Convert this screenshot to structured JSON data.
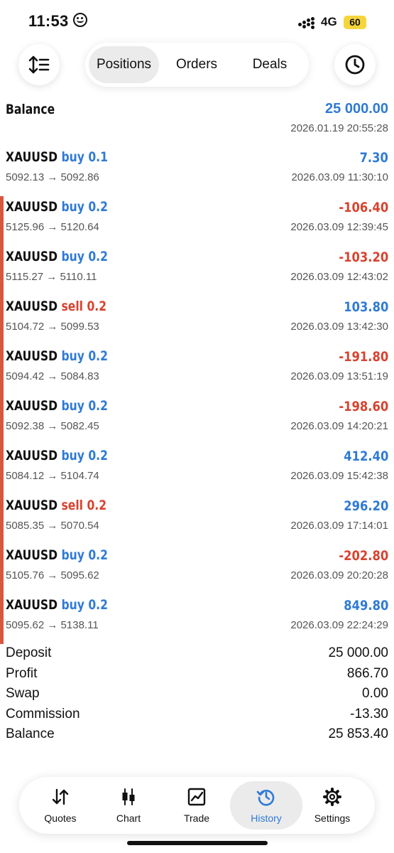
{
  "status": {
    "time": "11:53",
    "network": "4G",
    "battery": "60"
  },
  "header": {
    "segments": [
      {
        "label": "Positions",
        "active": true
      },
      {
        "label": "Orders",
        "active": false
      },
      {
        "label": "Deals",
        "active": false
      }
    ]
  },
  "balance": {
    "label": "Balance",
    "value": "25 000.00",
    "date": "2026.01.19 20:55:28"
  },
  "deals": [
    {
      "symbol": "XAUUSD",
      "side": "buy",
      "volume": "0.1",
      "prices": "5092.13 → 5092.86",
      "profit": "7.30",
      "date": "2026.03.09 11:30:10",
      "bar": false
    },
    {
      "symbol": "XAUUSD",
      "side": "buy",
      "volume": "0.2",
      "prices": "5125.96 → 5120.64",
      "profit": "-106.40",
      "date": "2026.03.09 12:39:45",
      "bar": true
    },
    {
      "symbol": "XAUUSD",
      "side": "buy",
      "volume": "0.2",
      "prices": "5115.27 → 5110.11",
      "profit": "-103.20",
      "date": "2026.03.09 12:43:02",
      "bar": true
    },
    {
      "symbol": "XAUUSD",
      "side": "sell",
      "volume": "0.2",
      "prices": "5104.72 → 5099.53",
      "profit": "103.80",
      "date": "2026.03.09 13:42:30",
      "bar": true
    },
    {
      "symbol": "XAUUSD",
      "side": "buy",
      "volume": "0.2",
      "prices": "5094.42 → 5084.83",
      "profit": "-191.80",
      "date": "2026.03.09 13:51:19",
      "bar": true
    },
    {
      "symbol": "XAUUSD",
      "side": "buy",
      "volume": "0.2",
      "prices": "5092.38 → 5082.45",
      "profit": "-198.60",
      "date": "2026.03.09 14:20:21",
      "bar": true
    },
    {
      "symbol": "XAUUSD",
      "side": "buy",
      "volume": "0.2",
      "prices": "5084.12 → 5104.74",
      "profit": "412.40",
      "date": "2026.03.09 15:42:38",
      "bar": true
    },
    {
      "symbol": "XAUUSD",
      "side": "sell",
      "volume": "0.2",
      "prices": "5085.35 → 5070.54",
      "profit": "296.20",
      "date": "2026.03.09 17:14:01",
      "bar": true
    },
    {
      "symbol": "XAUUSD",
      "side": "buy",
      "volume": "0.2",
      "prices": "5105.76 → 5095.62",
      "profit": "-202.80",
      "date": "2026.03.09 20:20:28",
      "bar": true
    },
    {
      "symbol": "XAUUSD",
      "side": "buy",
      "volume": "0.2",
      "prices": "5095.62 → 5138.11",
      "profit": "849.80",
      "date": "2026.03.09 22:24:29",
      "bar": true
    }
  ],
  "summary": [
    {
      "label": "Deposit",
      "value": "25 000.00"
    },
    {
      "label": "Profit",
      "value": "866.70"
    },
    {
      "label": "Swap",
      "value": "0.00"
    },
    {
      "label": "Commission",
      "value": "-13.30"
    },
    {
      "label": "Balance",
      "value": "25 853.40"
    }
  ],
  "tabbar": {
    "items": [
      {
        "label": "Quotes",
        "icon": "quotes-arrows-icon",
        "active": false
      },
      {
        "label": "Chart",
        "icon": "candlestick-icon",
        "active": false
      },
      {
        "label": "Trade",
        "icon": "trade-chart-icon",
        "active": false
      },
      {
        "label": "History",
        "icon": "history-clock-icon",
        "active": true
      },
      {
        "label": "Settings",
        "icon": "gear-icon",
        "active": false
      }
    ]
  },
  "colors": {
    "blue": "#2f7ad6",
    "red": "#d9422e",
    "accent_bar": "#d9573e",
    "battery": "#f5d53b"
  }
}
